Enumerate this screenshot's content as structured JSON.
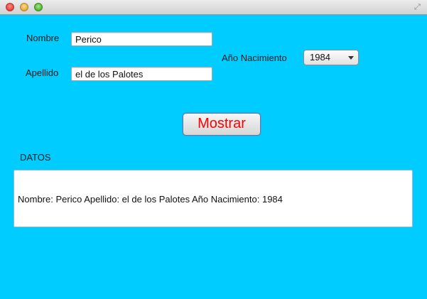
{
  "window": {
    "controls": [
      "close",
      "minimize",
      "maximize"
    ]
  },
  "form": {
    "nombre_label": "Nombre",
    "nombre_value": "Perico",
    "apellido_label": "Apellido",
    "apellido_value": "el de los Palotes",
    "anio_label": "Año Nacimiento",
    "anio_selected": "1984",
    "mostrar_label": "Mostrar"
  },
  "datos": {
    "label": "DATOS",
    "output": "Nombre: Perico Apellido: el de los Palotes Año Nacimiento: 1984"
  },
  "colors": {
    "background": "#00ccff",
    "button_text": "#ff0000"
  }
}
